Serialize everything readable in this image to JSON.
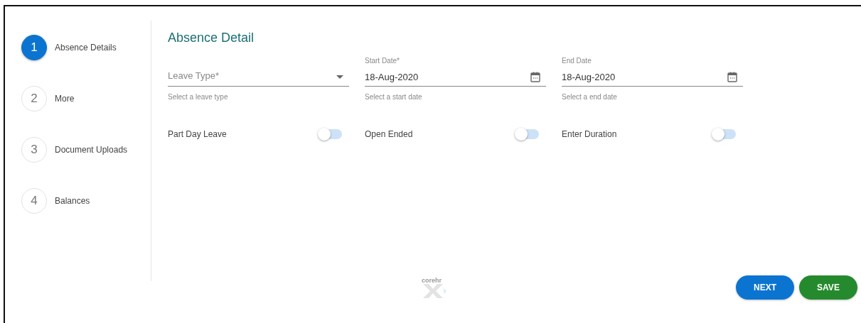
{
  "steps": [
    {
      "number": "1",
      "label": "Absence Details",
      "selected": true
    },
    {
      "number": "2",
      "label": "More",
      "selected": false
    },
    {
      "number": "3",
      "label": "Document Uploads",
      "selected": false
    },
    {
      "number": "4",
      "label": "Balances",
      "selected": false
    }
  ],
  "heading": "Absence Detail",
  "fields": [
    {
      "kind": "dropdown",
      "label": "Leave Type*",
      "hint": "Select a leave type"
    },
    {
      "kind": "date",
      "label": "Start Date*",
      "value": "18-Aug-2020",
      "hint": "Select a start date"
    },
    {
      "kind": "date",
      "label": "End Date",
      "value": "18-Aug-2020",
      "hint": "Select a end date"
    }
  ],
  "toggles": [
    {
      "label": "Part Day Leave",
      "on": false
    },
    {
      "label": "Open Ended",
      "on": false
    },
    {
      "label": "Enter Duration",
      "on": false
    }
  ],
  "footer": {
    "logo_text": "corehr",
    "buttons": [
      {
        "label": "NEXT",
        "kind": "primary"
      },
      {
        "label": "SAVE",
        "kind": "success"
      }
    ]
  }
}
